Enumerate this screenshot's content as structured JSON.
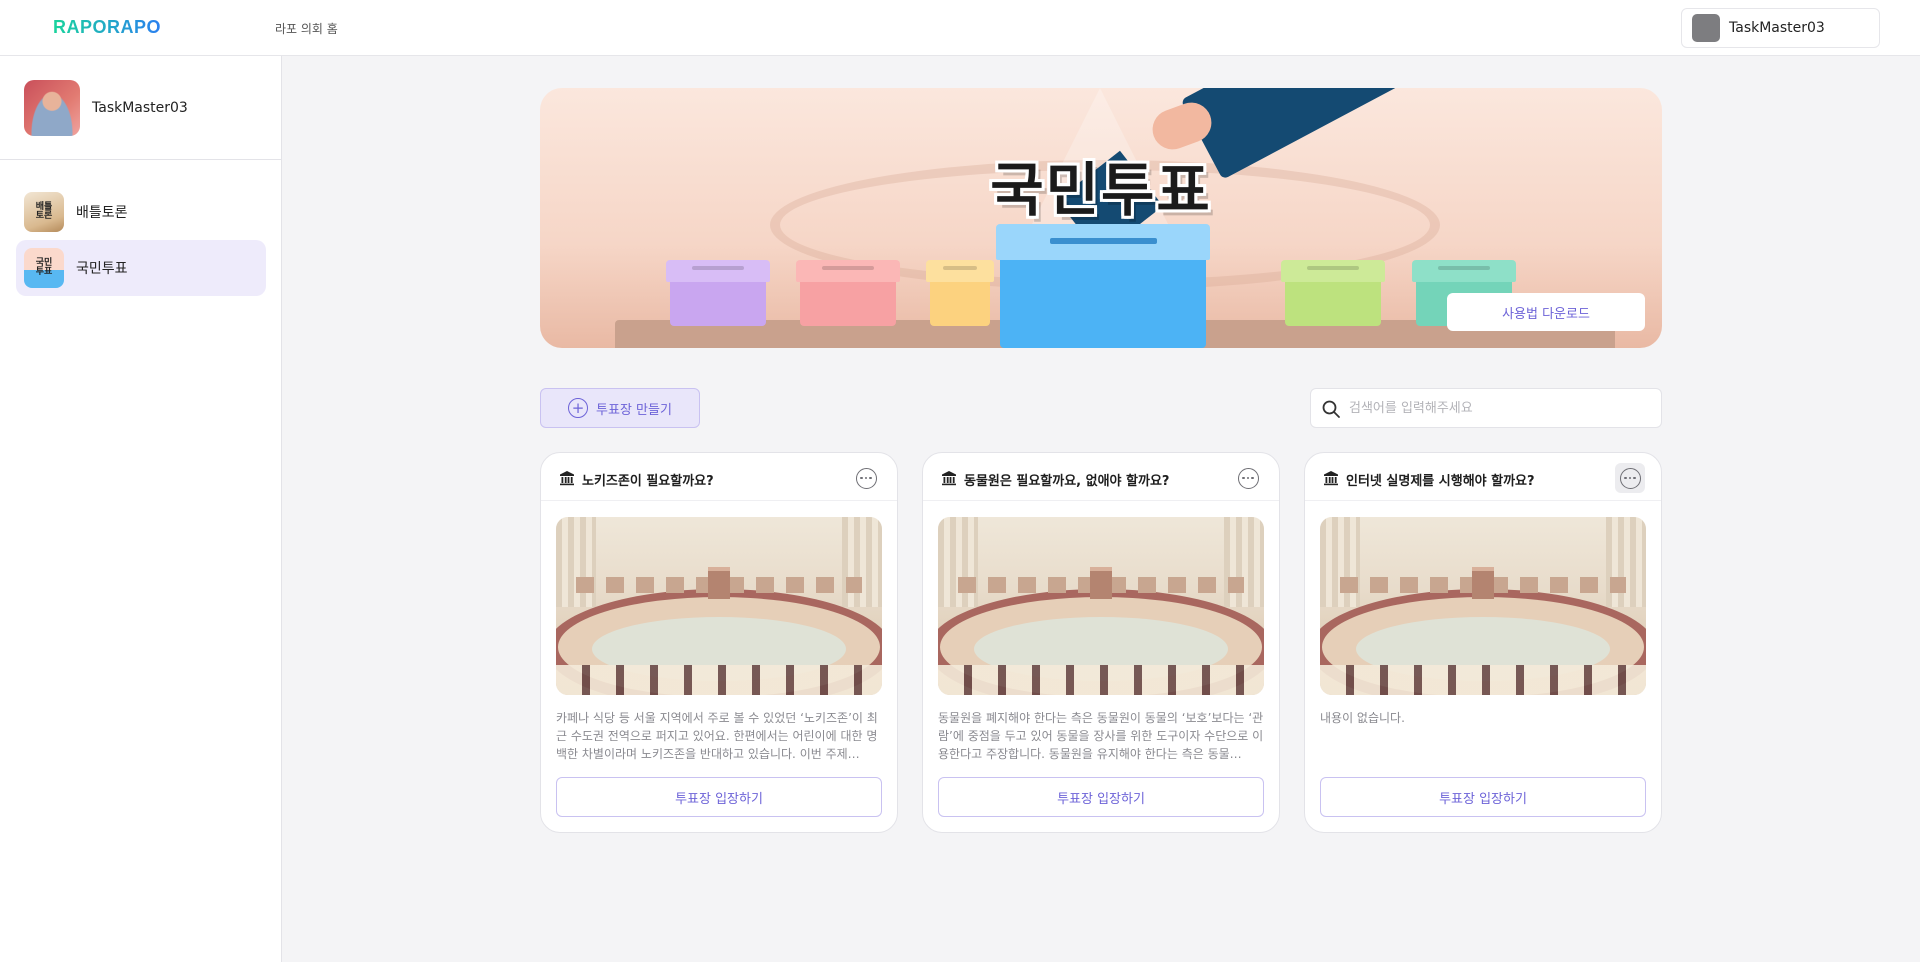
{
  "header": {
    "logo": "RAPORAPO",
    "home_link": "라포 의회 홈",
    "user_name": "TaskMaster03"
  },
  "sidebar": {
    "profile_name": "TaskMaster03",
    "items": [
      {
        "label": "배틀토론",
        "thumb_text": "배틀\n토론",
        "active": false
      },
      {
        "label": "국민투표",
        "thumb_text": "국민\n투표",
        "active": true
      }
    ]
  },
  "banner": {
    "title": "국민투표",
    "download_label": "사용법 다운로드"
  },
  "toolbar": {
    "create_label": "투표장 만들기",
    "search_placeholder": "검색어를 입력해주세요"
  },
  "cards": [
    {
      "title": "노키즈존이 필요할까요?",
      "description": "카페나 식당 등 서울 지역에서 주로 볼 수 있었던 ‘노키즈존’이 최근 수도권 전역으로 퍼지고 있어요. 한편에서는 어린이에 대한 명백한 차별이라며 노키즈존을 반대하고 있습니다. 이번 주제…",
      "button_label": "투표장 입장하기"
    },
    {
      "title": "동물원은 필요할까요, 없애야 할까요?",
      "description": "동물원을 폐지해야 한다는 측은 동물원이 동물의 ‘보호’보다는 ‘관람’에 중점을 두고 있어 동물을 장사를 위한 도구이자 수단으로 이용한다고 주장합니다. 동물원을 유지해야 한다는 측은 동물…",
      "button_label": "투표장 입장하기"
    },
    {
      "title": "인터넷 실명제를 시행해야 할까요?",
      "description": "내용이 없습니다.",
      "button_label": "투표장 입장하기"
    }
  ],
  "colors": {
    "accent": "#6d63d8",
    "active_bg": "#eeebfb",
    "logo_gradient_start": "#19d49c",
    "logo_gradient_end": "#2a7ff0"
  }
}
